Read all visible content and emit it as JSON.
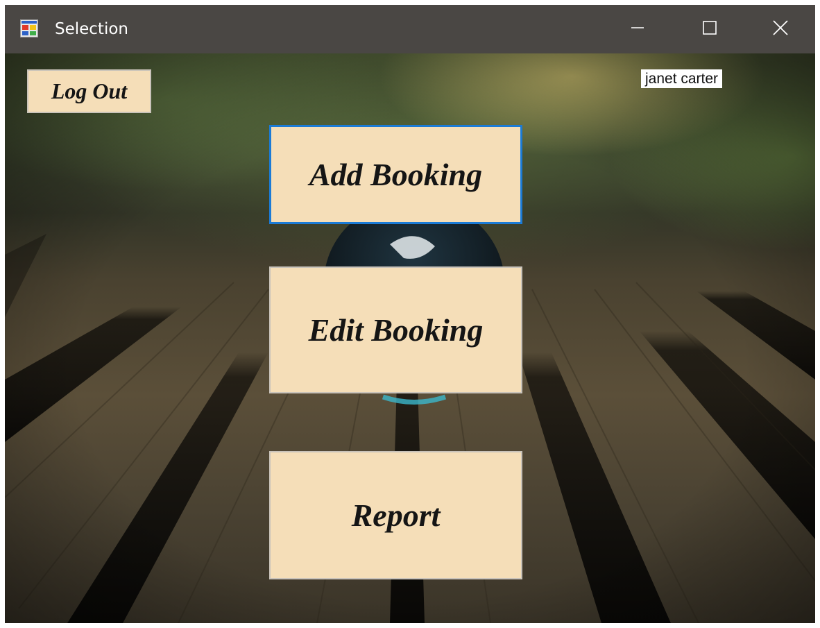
{
  "window": {
    "title": "Selection",
    "app_icon": "windows-form-icon",
    "controls": {
      "minimize_icon": "minimize-icon",
      "maximize_icon": "maximize-icon",
      "close_icon": "close-icon"
    }
  },
  "header": {
    "logout_label": "Log Out",
    "user_name": "janet carter"
  },
  "menu": {
    "add_booking_label": "Add Booking",
    "edit_booking_label": "Edit Booking",
    "report_label": "Report"
  },
  "colors": {
    "titlebar": "#4a4744",
    "button_fill": "#f5deb8",
    "focus_border": "#1b7bd6",
    "button_text": "#151515"
  }
}
